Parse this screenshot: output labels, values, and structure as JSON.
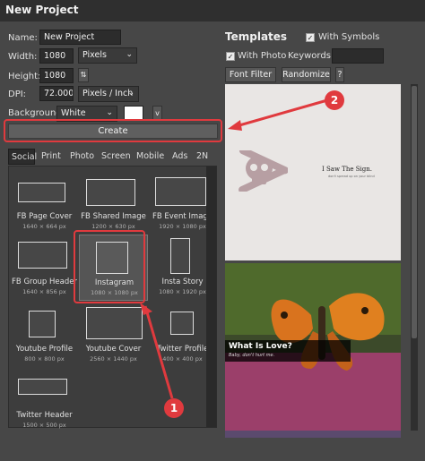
{
  "window": {
    "title": "New Project"
  },
  "form": {
    "name_label": "Name:",
    "name_value": "New Project",
    "width_label": "Width:",
    "width_value": "1080",
    "unit_value": "Pixels",
    "height_label": "Height:",
    "height_value": "1080",
    "swap_icon": "swap-icon",
    "dpi_label": "DPI:",
    "dpi_value": "72.000",
    "dpi_unit_value": "Pixels / Inch",
    "background_label": "Background:",
    "background_value": "White",
    "swatch_color": "#ffffff",
    "more_label": "v"
  },
  "create_label": "Create",
  "tabs": [
    "Social",
    "Print",
    "Photo",
    "Screen",
    "Mobile",
    "Ads",
    "2N"
  ],
  "presets": [
    {
      "name": "FB Page Cover",
      "dim": "1640 × 664 px"
    },
    {
      "name": "FB Shared Image",
      "dim": "1200 × 630 px"
    },
    {
      "name": "FB Event Image",
      "dim": "1920 × 1080 px"
    },
    {
      "name": "FB Group Header",
      "dim": "1640 × 856 px"
    },
    {
      "name": "Instagram",
      "dim": "1080 × 1080 px"
    },
    {
      "name": "Insta Story",
      "dim": "1080 × 1920 px"
    },
    {
      "name": "Youtube Profile",
      "dim": "800 × 800 px"
    },
    {
      "name": "Youtube Cover",
      "dim": "2560 × 1440 px"
    },
    {
      "name": "Twitter Profile",
      "dim": "400 × 400 px"
    },
    {
      "name": "Twitter Header",
      "dim": "1500 × 500 px"
    }
  ],
  "templates": {
    "title": "Templates",
    "with_symbols": "With Symbols",
    "with_photo": "With Photo",
    "keywords_label": "Keywords:",
    "keywords_value": "",
    "font_filter": "Font Filter ▼",
    "randomize": "Randomize",
    "help": "?",
    "preview1_text": "I Saw The Sign.",
    "preview1_small": "don't spread up on your blind",
    "preview2_title": "What Is Love?",
    "preview2_sub": "Baby, don't hurt me."
  },
  "annotations": {
    "badge1": "1",
    "badge2": "2"
  },
  "colors": {
    "accent_red": "#e03a3e",
    "background": "#474747"
  }
}
